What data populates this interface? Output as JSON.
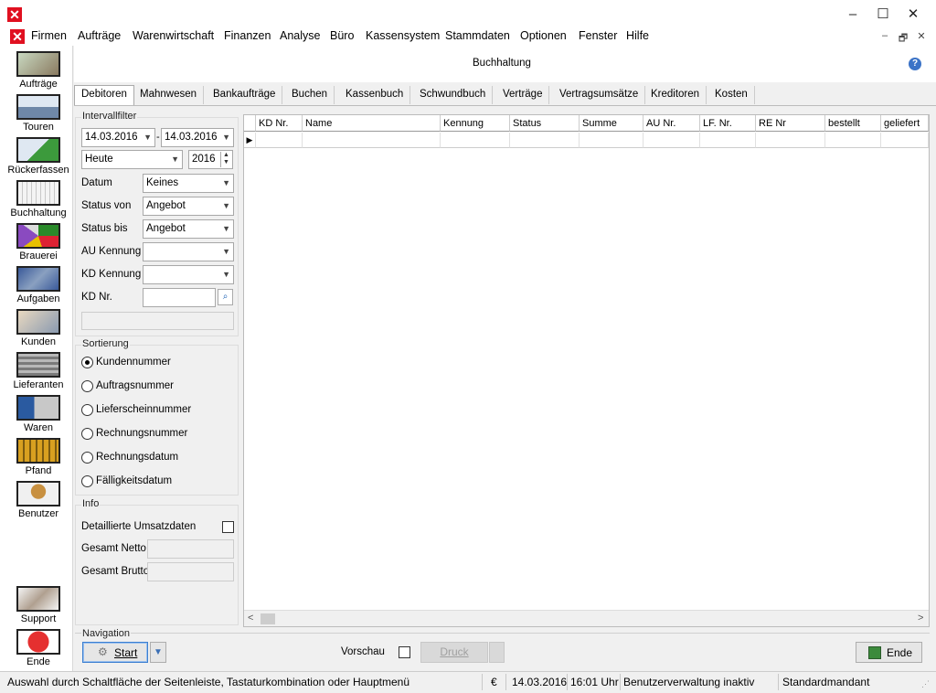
{
  "window": {
    "minimize": "–",
    "maximize": "☐",
    "close": "✕"
  },
  "menu": [
    "Firmen",
    "Aufträge",
    "Warenwirtschaft",
    "Finanzen",
    "Analyse",
    "Büro",
    "Kassensystem",
    "Stammdaten",
    "Optionen",
    "Fenster",
    "Hilfe"
  ],
  "mdi": {
    "minimize": "–",
    "restore": "🗗",
    "close": "✕"
  },
  "sidebar": {
    "items": [
      {
        "label": "Aufträge",
        "icon": "headset-operator-icon"
      },
      {
        "label": "Touren",
        "icon": "truck-icon"
      },
      {
        "label": "Rückerfassen",
        "icon": "truck-check-icon"
      },
      {
        "label": "Buchhaltung",
        "icon": "ledger-icon"
      },
      {
        "label": "Brauerei",
        "icon": "brewery-chart-icon"
      },
      {
        "label": "Aufgaben",
        "icon": "tasks-icon"
      },
      {
        "label": "Kunden",
        "icon": "customers-icon"
      },
      {
        "label": "Lieferanten",
        "icon": "warehouse-icon"
      },
      {
        "label": "Waren",
        "icon": "goods-icon"
      },
      {
        "label": "Pfand",
        "icon": "crate-icon"
      },
      {
        "label": "Benutzer",
        "icon": "user-lock-icon"
      }
    ],
    "bottom": [
      {
        "label": "Support",
        "icon": "handshake-icon"
      },
      {
        "label": "Ende",
        "icon": "power-icon"
      }
    ]
  },
  "header": {
    "title": "Buchhaltung",
    "help": "?"
  },
  "tabs": [
    "Debitoren",
    "Mahnwesen",
    "Bankaufträge",
    "Buchen",
    "Kassenbuch",
    "Schwundbuch",
    "Verträge",
    "Vertragsumsätze",
    "Kreditoren",
    "Kosten"
  ],
  "interval": {
    "label": "Intervallfilter",
    "from": "14.03.2016",
    "dash": "-",
    "to": "14.03.2016",
    "period": "Heute",
    "year": "2016"
  },
  "filters": [
    {
      "label": "Datum",
      "value": "Keines"
    },
    {
      "label": "Status von",
      "value": "Angebot"
    },
    {
      "label": "Status bis",
      "value": "Angebot"
    },
    {
      "label": "AU Kennung",
      "value": ""
    },
    {
      "label": "KD Kennung",
      "value": ""
    }
  ],
  "kdnr": {
    "label": "KD Nr.",
    "value": ""
  },
  "sort": {
    "label": "Sortierung",
    "options": [
      "Kundennummer",
      "Auftragsnummer",
      "Lieferscheinnummer",
      "Rechnungsnummer",
      "Rechnungsdatum",
      "Fälligkeitsdatum"
    ],
    "selected": 0
  },
  "info": {
    "label": "Info",
    "detail_label": "Detaillierte Umsatzdaten",
    "netto_label": "Gesamt Netto",
    "brutto_label": "Gesamt Brutto"
  },
  "grid": {
    "columns": [
      "KD Nr.",
      "Name",
      "Kennung",
      "Status",
      "Summe",
      "AU Nr.",
      "LF. Nr.",
      "RE Nr",
      "bestellt",
      "geliefert"
    ]
  },
  "navigation": {
    "label": "Navigation",
    "start": "Start",
    "preview": "Vorschau",
    "print": "Druck",
    "end": "Ende"
  },
  "status": {
    "hint": "Auswahl durch Schaltfläche der Seitenleiste, Tastaturkombination oder Hauptmenü",
    "currency": "€",
    "date": "14.03.2016",
    "time": "16:01 Uhr",
    "uservw": "Benutzerverwaltung inaktiv",
    "tenant": "Standardmandant"
  }
}
